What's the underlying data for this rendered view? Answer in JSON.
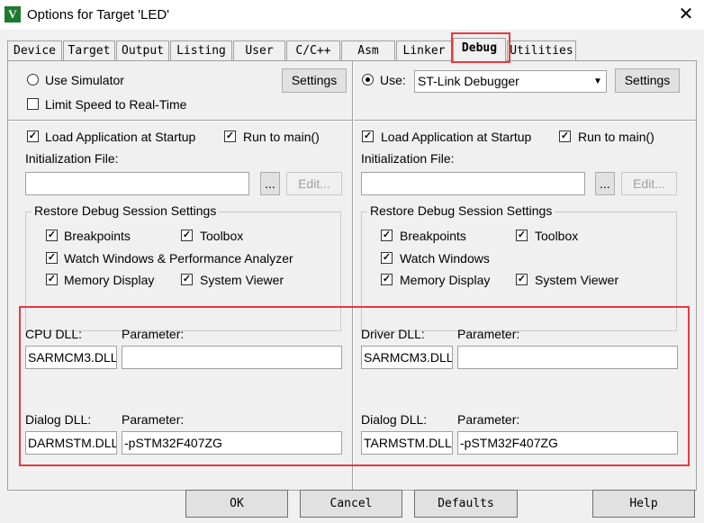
{
  "window": {
    "title": "Options for Target 'LED'",
    "app_icon": "V"
  },
  "tabs": [
    "Device",
    "Target",
    "Output",
    "Listing",
    "User",
    "C/C++",
    "Asm",
    "Linker",
    "Debug",
    "Utilities"
  ],
  "active_tab": "Debug",
  "left": {
    "use_simulator": "Use Simulator",
    "limit_speed": "Limit Speed to Real-Time",
    "settings": "Settings",
    "load_app": "Load Application at Startup",
    "run_to_main": "Run to main()",
    "init_file_label": "Initialization File:",
    "init_file_value": "",
    "browse": "...",
    "edit": "Edit...",
    "restore_title": "Restore Debug Session Settings",
    "breakpoints": "Breakpoints",
    "toolbox": "Toolbox",
    "watch_windows": "Watch Windows & Performance Analyzer",
    "memory_display": "Memory Display",
    "system_viewer": "System Viewer",
    "cpu_dll_label": "CPU DLL:",
    "cpu_dll_value": "SARMCM3.DLL",
    "param_label": "Parameter:",
    "cpu_param_value": "",
    "dialog_dll_label": "Dialog DLL:",
    "dialog_dll_value": "DARMSTM.DLL",
    "dialog_param_value": "-pSTM32F407ZG"
  },
  "right": {
    "use_label": "Use:",
    "debugger": "ST-Link Debugger",
    "settings": "Settings",
    "load_app": "Load Application at Startup",
    "run_to_main": "Run to main()",
    "init_file_label": "Initialization File:",
    "init_file_value": "",
    "browse": "...",
    "edit": "Edit...",
    "restore_title": "Restore Debug Session Settings",
    "breakpoints": "Breakpoints",
    "toolbox": "Toolbox",
    "watch_windows": "Watch Windows",
    "memory_display": "Memory Display",
    "system_viewer": "System Viewer",
    "driver_dll_label": "Driver DLL:",
    "driver_dll_value": "SARMCM3.DLL",
    "param_label": "Parameter:",
    "driver_param_value": "",
    "dialog_dll_label": "Dialog DLL:",
    "dialog_dll_value": "TARMSTM.DLL",
    "dialog_param_value": "-pSTM32F407ZG"
  },
  "footer": {
    "ok": "OK",
    "cancel": "Cancel",
    "defaults": "Defaults",
    "help": "Help"
  },
  "checkmark": "✓",
  "close_glyph": "✕",
  "highlight_color": "#e8393d"
}
